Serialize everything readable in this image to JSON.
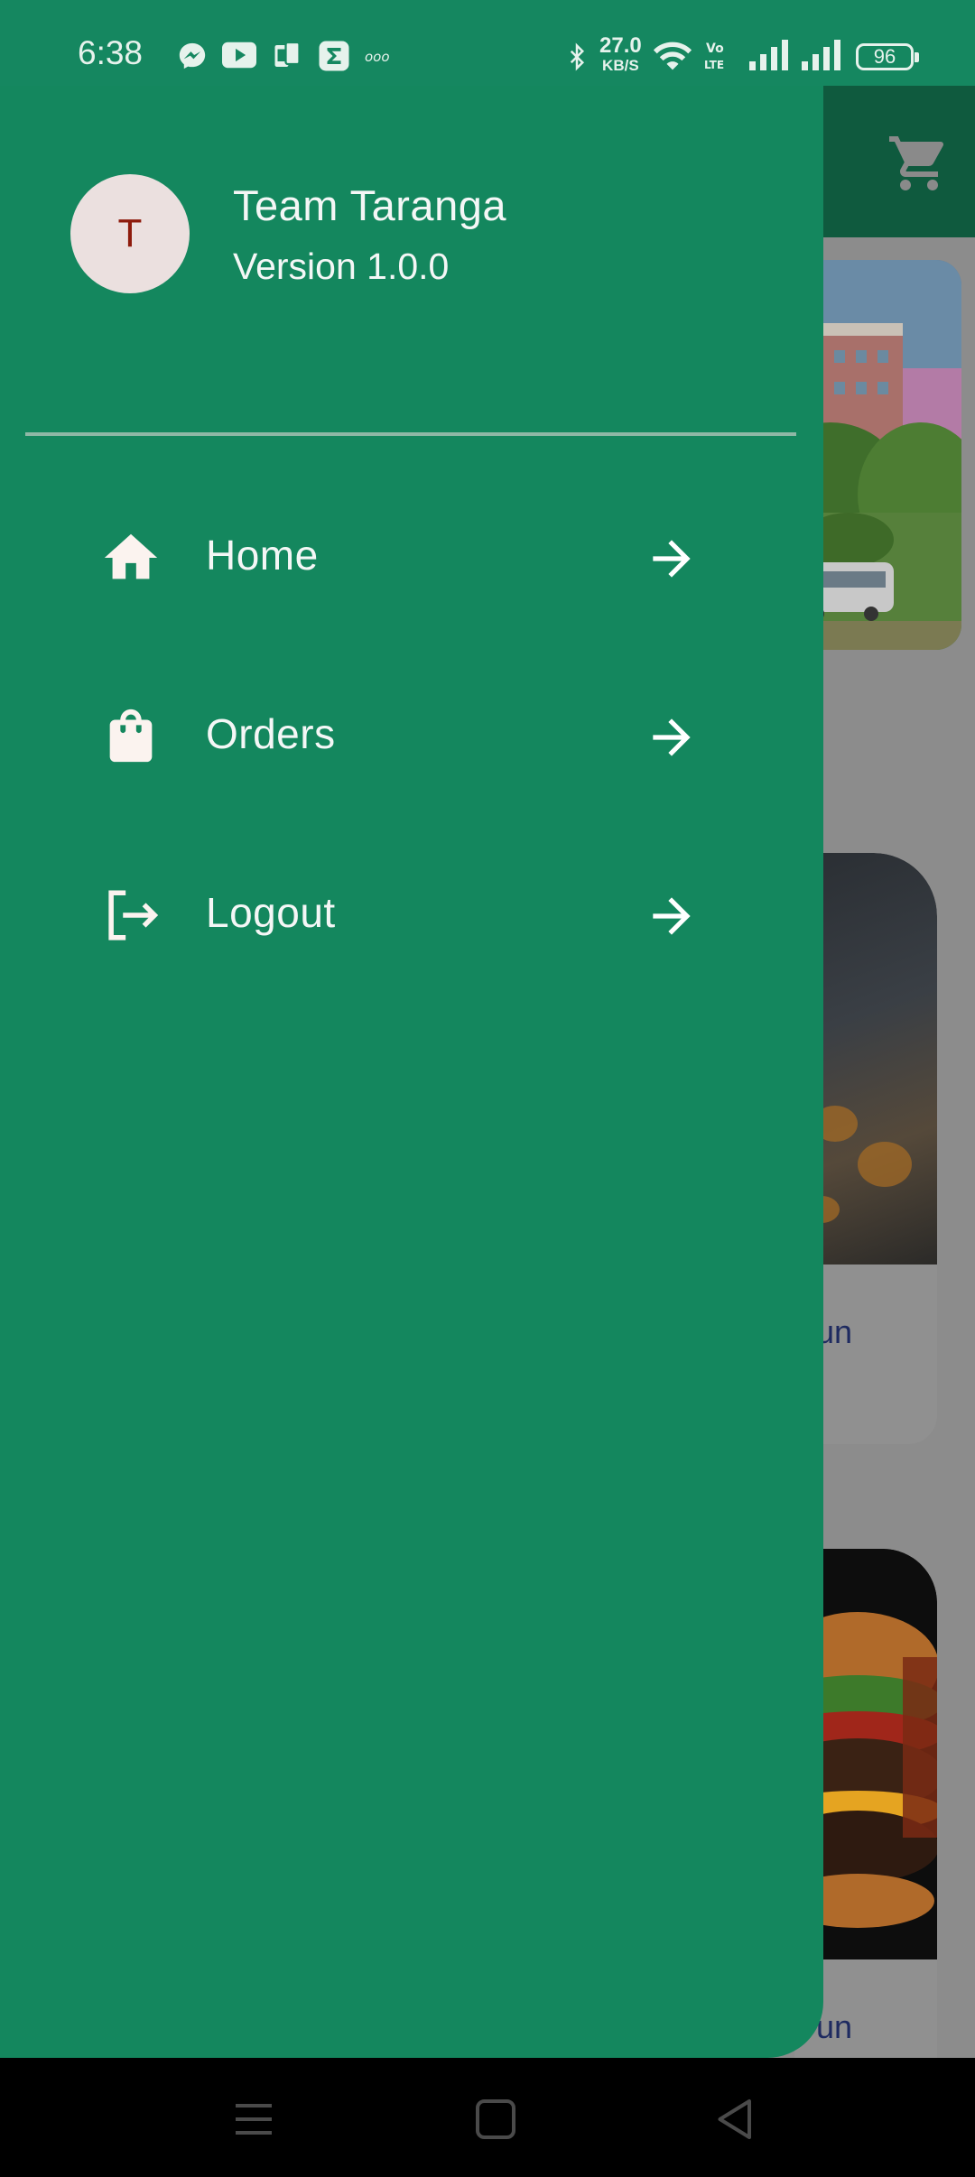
{
  "status_bar": {
    "time": "6:38",
    "net_speed_value": "27.0",
    "net_speed_unit": "KB/S",
    "battery": "96",
    "icons": [
      "messenger-icon",
      "youtube-icon",
      "phone-clone-icon",
      "sigma-app-icon",
      "rcs-icon",
      "bluetooth-icon",
      "wifi-icon",
      "volte-icon",
      "signal-icon",
      "signal-icon"
    ]
  },
  "drawer": {
    "avatar_initial": "T",
    "name": "Team Taranga",
    "version": "Version 1.0.0",
    "menu": [
      {
        "label": "Home",
        "icon": "home-icon"
      },
      {
        "label": "Orders",
        "icon": "shopping-bag-icon"
      },
      {
        "label": "Logout",
        "icon": "logout-icon"
      }
    ]
  },
  "background": {
    "card1_text": "un",
    "card2_text": "un"
  },
  "colors": {
    "drawer": "#14875e",
    "appbar": "#0f5a3e",
    "avatar_bg": "#ebe0df",
    "avatar_text": "#8e1b0c",
    "scrim": "#8c8c8c"
  }
}
